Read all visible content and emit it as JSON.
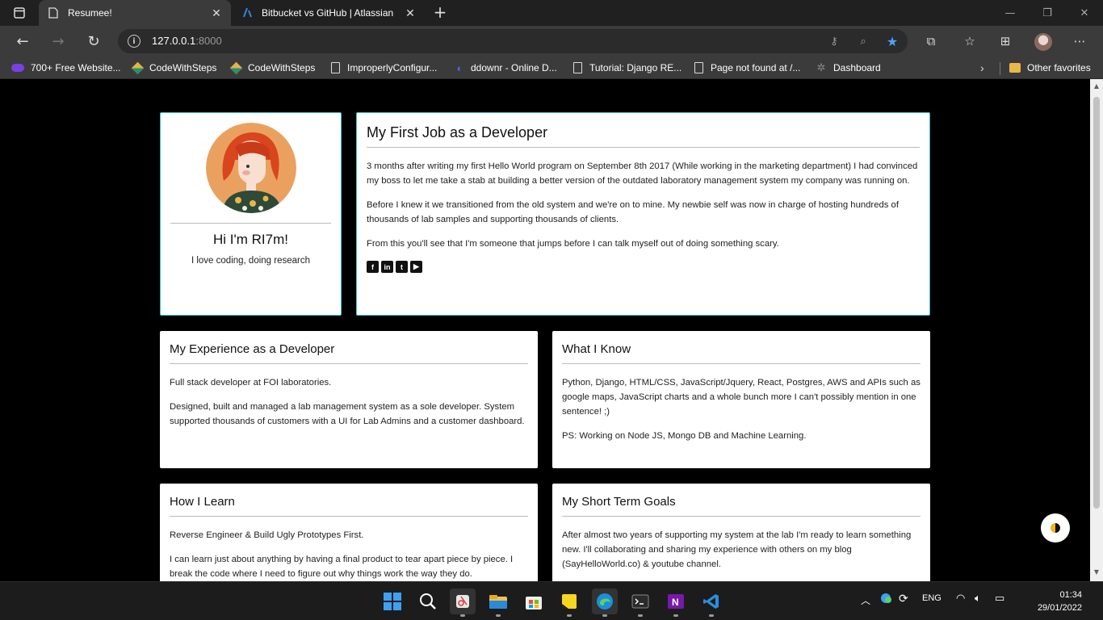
{
  "browser": {
    "tabs": [
      {
        "title": "Resumee!",
        "active": true
      },
      {
        "title": "Bitbucket vs GitHub | Atlassian",
        "active": false
      }
    ],
    "url_host": "127.0.0.1",
    "url_port": ":8000",
    "bookmarks": [
      {
        "label": "700+ Free Website...",
        "icon": "canva-icon"
      },
      {
        "label": "CodeWithSteps",
        "icon": "codewithsteps-icon"
      },
      {
        "label": "CodeWithSteps",
        "icon": "codewithsteps-icon"
      },
      {
        "label": "ImproperlyConfigur...",
        "icon": "page-icon"
      },
      {
        "label": "ddownr - Online D...",
        "icon": "ddownr-icon"
      },
      {
        "label": "Tutorial: Django RE...",
        "icon": "page-icon"
      },
      {
        "label": "Page not found at /...",
        "icon": "page-icon"
      },
      {
        "label": "Dashboard",
        "icon": "gear-icon"
      }
    ],
    "other_favorites": "Other favorites"
  },
  "profile": {
    "greeting": "Hi I'm RI7m!",
    "tagline": "I love coding, doing research"
  },
  "first_job": {
    "title": "My First Job as a Developer",
    "paragraphs": [
      "3 months after writing my first Hello World program on September 8th 2017 (While working in the marketing department) I had convinced my boss to let me take a stab at building a better version of the outdated laboratory management system my company was running on.",
      "Before I knew it we transitioned from the old system and we're on to mine. My newbie self was now in charge of hosting hundreds of thousands of lab samples and supporting thousands of clients.",
      "From this you'll see that I'm someone that jumps before I can talk myself out of doing something scary."
    ],
    "socials": [
      "facebook-icon",
      "linkedin-icon",
      "twitter-icon",
      "youtube-icon"
    ]
  },
  "experience": {
    "title": "My Experience as a Developer",
    "paragraphs": [
      "Full stack developer at FOI laboratories.",
      "Designed, built and managed a lab management system as a sole developer. System supported thousands of customers with a UI for Lab Admins and a customer dashboard."
    ]
  },
  "know": {
    "title": "What I Know",
    "paragraphs": [
      "Python, Django, HTML/CSS, JavaScript/Jquery, React, Postgres, AWS and APIs such as google maps, JavaScript charts and a whole bunch more I can't possibly mention in one sentence! ;)",
      "PS: Working on Node JS, Mongo DB and Machine Learning."
    ]
  },
  "learn": {
    "title": "How I Learn",
    "paragraphs": [
      "Reverse Engineer & Build Ugly Prototypes First.",
      "I can learn just about anything by having a final product to tear apart piece by piece. I break the code where I need to figure out why things work the way they do."
    ]
  },
  "goals": {
    "title": "My Short Term Goals",
    "paragraphs": [
      "After almost two years of supporting my system at the lab I'm ready to learn something new. I'll collaborating and sharing my experience with others on my blog (SayHelloWorld.co) & youtube channel."
    ]
  },
  "taskbar": {
    "lang": "ENG",
    "time": "01:34",
    "date": "29/01/2022"
  }
}
